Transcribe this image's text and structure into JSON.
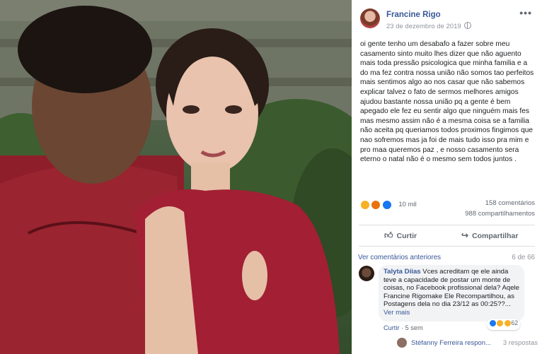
{
  "post": {
    "author": "Francine Rigo",
    "date": "23 de dezembro de 2019",
    "text": "oi gente tenho um desabafo a fazer sobre meu casamento sinto muito lhes dizer que não aguento mais toda pressão psicologica que minha familia e a do ma fez contra nossa união não somos tao perfeitos mais sentimos algo ao nos casar que não sabemos explicar talvez o fato de sermos melhores amigos ajudou bastante nossa união pq a gente é bem apegado ele fez eu sentir algo que ninguém mais fes mas mesmo assim não é a mesma coisa se a familia não aceita pq queriamos todos proximos fingimos que nao sofremos mas ja foi de mais tudo isso pra mim e pro maa queremos paz , e nosso casamento sera eterno o natal não é o mesmo sem todos juntos .",
    "reactions_count": "10 mil",
    "comments_count": "158 comentários",
    "shares_count": "988 compartilhamentos",
    "reaction_icons": [
      "sad-reaction",
      "angry-reaction",
      "like-reaction"
    ],
    "more_label": "•••"
  },
  "actions": {
    "like": "Curtir",
    "share": "Compartilhar"
  },
  "comments_section": {
    "previous_link": "Ver comentários anteriores",
    "pager": "6 de 66",
    "comment": {
      "author": "Talyta Diias",
      "text": "Vces acreditam qe ele ainda teve a capacidade de postar um monte de coisas, no Facebook profissional dela? Aqele Francine Rigomake Ele Recompartilhou, as Postagens dela no dia 23/12 as 00:25??...",
      "see_more": "Ver mais",
      "mention": "Francine Rigomake",
      "reaction_count": "62",
      "like_action": "Curtir",
      "time": "5 sem"
    },
    "reply": {
      "author": "Stéfanny Ferreira respon...",
      "count": "3 respostas"
    }
  }
}
